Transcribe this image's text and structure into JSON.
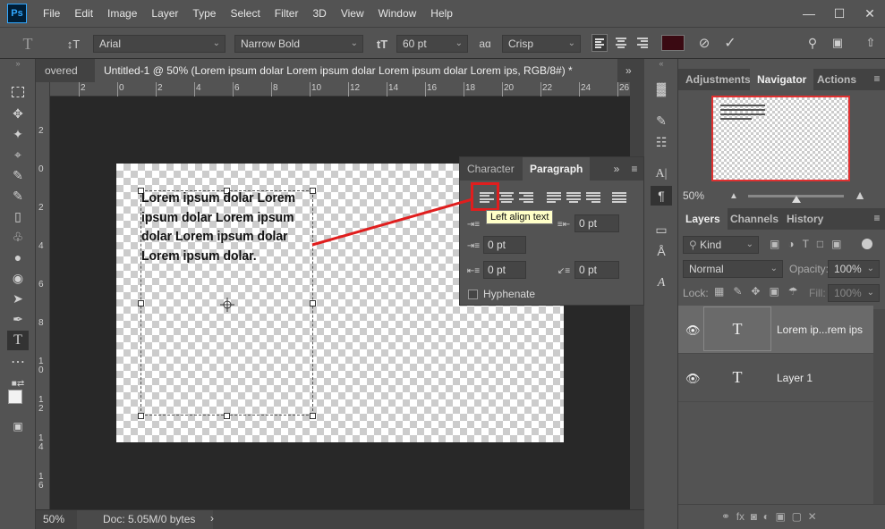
{
  "app": {
    "logo": "Ps"
  },
  "menu": [
    "File",
    "Edit",
    "Image",
    "Layer",
    "Type",
    "Select",
    "Filter",
    "3D",
    "View",
    "Window",
    "Help"
  ],
  "window_controls": {
    "minimize": "—",
    "maximize": "☐",
    "close": "✕"
  },
  "options": {
    "tool_glyph": "T",
    "orient_glyph": "↕T",
    "font_family": "Arial",
    "font_style": "Narrow Bold",
    "size_glyph": "tT",
    "font_size": "60 pt",
    "aa_glyph": "aɑ",
    "antialias": "Crisp",
    "text_color": "#3a0a12"
  },
  "tabs": {
    "prev": "overed",
    "active": "Untitled-1 @ 50% (Lorem ipsum dolar Lorem ipsum dolar Lorem ipsum dolar Lorem ips, RGB/8#) *"
  },
  "ruler_h": [
    "2",
    "0",
    "2",
    "4",
    "6",
    "8",
    "10",
    "12",
    "14",
    "16",
    "18",
    "20",
    "22",
    "24",
    "26"
  ],
  "ruler_v": [
    "2",
    "0",
    "2",
    "4",
    "6",
    "8",
    "1 0",
    "1 2",
    "1 4",
    "1 6"
  ],
  "canvas_text": [
    "Lorem ipsum dolar Lorem",
    "ipsum dolar Lorem ipsum",
    "dolar Lorem ipsum dolar",
    "Lorem ipsum dolar."
  ],
  "status": {
    "zoom": "50%",
    "doc": "Doc: 5.05M/0 bytes",
    "arrow": "›"
  },
  "paragraph_panel": {
    "tabs": [
      "Character",
      "Paragraph"
    ],
    "tooltip": "Left align text",
    "indent_left": "0 pt",
    "indent_right": "0 pt",
    "indent_first": "0 pt",
    "space_before": "0 pt",
    "space_after": "0 pt",
    "hyphenate_label": "Hyphenate",
    "menu_glyph": "»"
  },
  "right_panels": {
    "top_tabs": [
      "Adjustments",
      "Navigator",
      "Actions"
    ],
    "navigator_zoom": "50%",
    "layer_tabs": [
      "Layers",
      "Channels",
      "History"
    ],
    "filter_kind": "Kind",
    "blend_mode": "Normal",
    "opacity_label": "Opacity:",
    "opacity_value": "100%",
    "lock_label": "Lock:",
    "fill_label": "Fill:",
    "fill_value": "100%",
    "layers": [
      {
        "name": "Lorem ip...rem ips",
        "thumb": "T"
      },
      {
        "name": "Layer 1",
        "thumb": "T"
      }
    ],
    "footer_icons": "⚭  fx  ◙  ◐  ▣  ▢  ✕"
  },
  "colors": {
    "accent_red": "#e01e1e",
    "navigator_frame": "#e03030"
  }
}
